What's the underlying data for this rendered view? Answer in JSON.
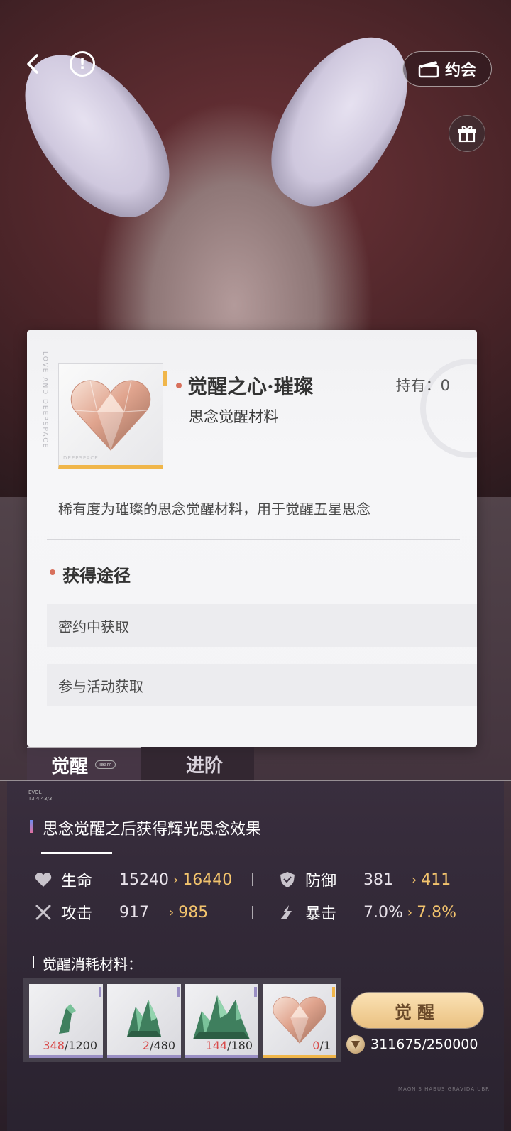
{
  "top_bar": {
    "date_button": "约会"
  },
  "item_card": {
    "name": "觉醒之心·璀璨",
    "type": "思念觉醒材料",
    "owned": "持有：0",
    "description": "稀有度为璀璨的思念觉醒材料，用于觉醒五星思念",
    "source_title": "获得途径",
    "sources": [
      "密约中获取",
      "参与活动获取"
    ]
  },
  "tabs": [
    {
      "label": "觉醒",
      "active": true
    },
    {
      "label": "进阶",
      "active": false
    }
  ],
  "awaken_effect": "思念觉醒之后获得辉光思念效果",
  "stats": [
    {
      "label": "生命",
      "base": "15240",
      "next": "16440",
      "icon": "heart-icon"
    },
    {
      "label": "防御",
      "base": "381",
      "next": "411",
      "icon": "shield-icon"
    },
    {
      "label": "攻击",
      "base": "917",
      "next": "985",
      "icon": "sword-icon"
    },
    {
      "label": "暴击",
      "base": "7.0%",
      "next": "7.8%",
      "icon": "burst-icon"
    }
  ],
  "materials_label": "觉醒消耗材料：",
  "materials": [
    {
      "have": "348",
      "need": "/1200",
      "icon": "green-crystal-small-icon"
    },
    {
      "have": "2",
      "need": "/480",
      "icon": "green-crystal-medium-icon"
    },
    {
      "have": "144",
      "need": "/180",
      "icon": "green-crystal-large-icon"
    },
    {
      "have": "0",
      "need": "/1",
      "icon": "radiant-heart-icon"
    }
  ],
  "awaken_button": "觉醒",
  "cost": "311675/250000",
  "colors": {
    "accent_gold": "#f3c46d",
    "warning_red": "#d94c4c",
    "card_bg": "#f4f4f6",
    "dot": "#d8705c"
  }
}
